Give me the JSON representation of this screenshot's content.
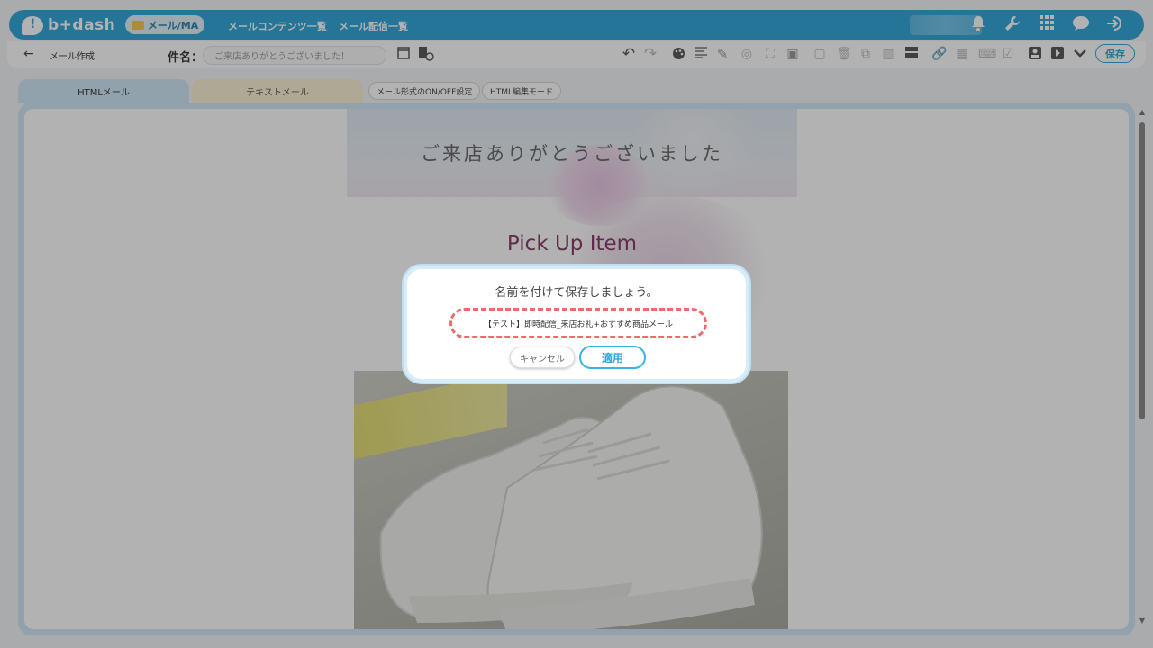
{
  "app": {
    "logo_text": "b+dash",
    "nav_pill_label": "メール/MA",
    "nav_links": [
      "メールコンテンツ一覧",
      "メール配信一覧"
    ],
    "nav_icons": [
      "bell-icon",
      "wrench-icon",
      "apps-grid-icon",
      "chat-icon",
      "logout-icon"
    ]
  },
  "toolbar": {
    "title": "メール作成",
    "subject_label": "件名：",
    "subject_value": "ご来店ありがとうございました！",
    "save_label": "保存"
  },
  "tabs": {
    "html": "HTMLメール",
    "text": "テキストメール",
    "onoff": "メール形式のON/OFF設定",
    "html_edit": "HTML編集モード"
  },
  "mail": {
    "header_text": "ご来店ありがとうございました",
    "pick_title": "Pick Up Item"
  },
  "dialog": {
    "title": "名前を付けて保存しましょう。",
    "input_value": "【テスト】即時配信_来店お礼+おすすめ商品メール",
    "cancel_label": "キャンセル",
    "apply_label": "適用"
  },
  "colors": {
    "brand_blue": "#2ea4d8",
    "tab_html_bg": "#cfe8f6",
    "tab_text_bg": "#fbf1d4",
    "highlight_dashed": "#ef6a6a",
    "pick_title": "#8a3766"
  }
}
